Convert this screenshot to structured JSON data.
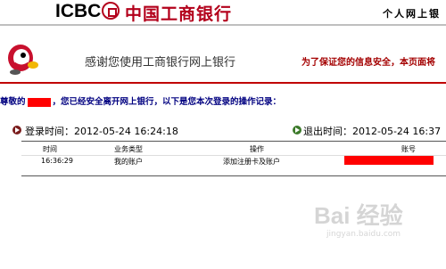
{
  "header": {
    "logo_text": "ICBC",
    "logo_cn": "中国工商银行",
    "personal": "个人网上银"
  },
  "welcome": "感谢您使用工商银行网上银行",
  "security_note": "为了保证您的信息安全，本页面将",
  "greeting": {
    "prefix": "尊敬的",
    "message": "，您已经安全离开网上银行，以下是您本次登录的操作记录："
  },
  "session": {
    "login_label": "登录时间：2012-05-24 16:24:18",
    "logout_label": "退出时间：2012-05-24 16:37"
  },
  "table": {
    "headers": [
      "时间",
      "业务类型",
      "操作",
      "账号"
    ],
    "rows": [
      {
        "time": "16:36:29",
        "type": "我的账户",
        "op": "添加注册卡及账户"
      }
    ]
  },
  "watermark": {
    "text": "Bai 经验",
    "sub": "jingyan.baidu.com"
  },
  "colors": {
    "brand_red": "#b3001b",
    "accent_red": "#c00000",
    "redaction": "#ff0000"
  }
}
